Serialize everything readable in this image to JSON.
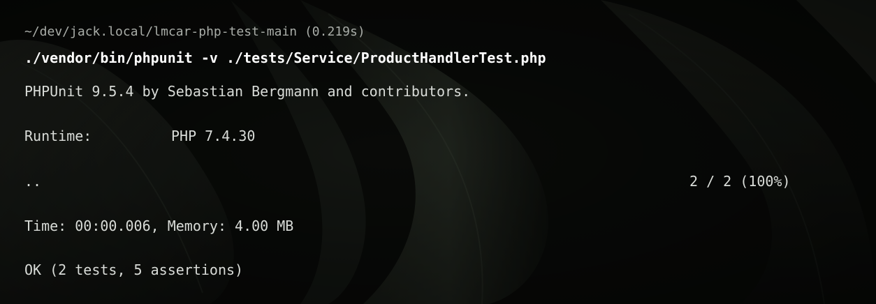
{
  "terminal": {
    "cwd_line": "~/dev/jack.local/lmcar-php-test-main (0.219s)",
    "command": "./vendor/bin/phpunit -v ./tests/Service/ProductHandlerTest.php",
    "output": {
      "banner": "PHPUnit 9.5.4 by Sebastian Bergmann and contributors.",
      "runtime_label": "Runtime:",
      "runtime_value": "PHP 7.4.30",
      "progress_dots": "..",
      "progress_count": "2 / 2 (100%)",
      "time_memory": "Time: 00:00.006, Memory: 4.00 MB",
      "result": "OK (2 tests, 5 assertions)"
    }
  },
  "theme": {
    "background": "#0b0d0b",
    "text": "#d9dcd8",
    "command_text": "#ffffff",
    "cwd_text": "#a9ada8"
  }
}
